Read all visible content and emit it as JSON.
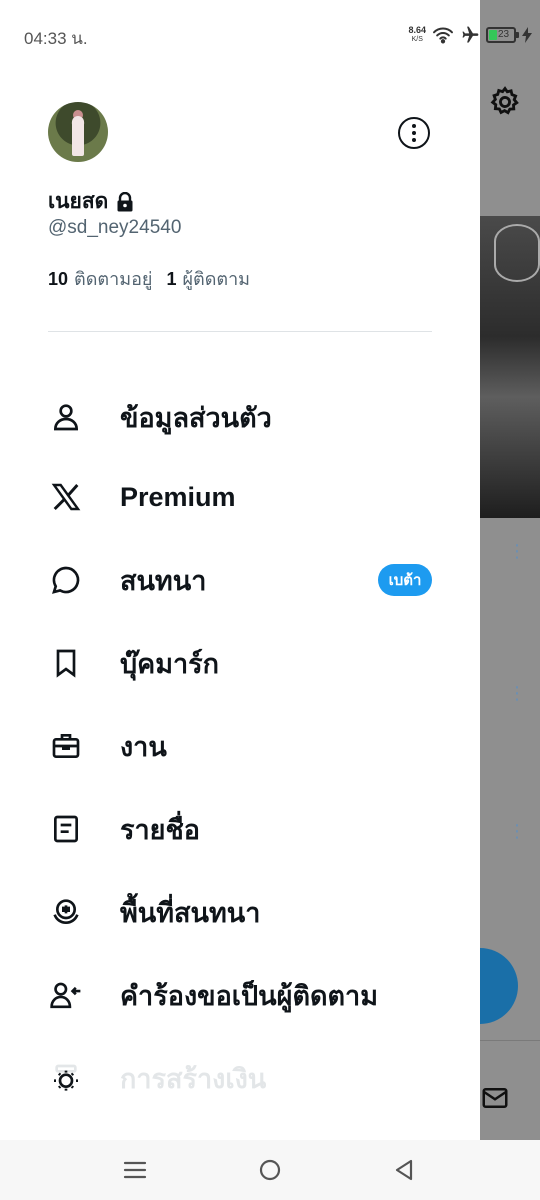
{
  "status_bar": {
    "time": "04:33 น.",
    "net_speed_value": "8.64",
    "net_speed_unit": "K/S",
    "battery_level": "23"
  },
  "profile": {
    "display_name": "เนยสด",
    "handle": "@sd_ney24540",
    "following_count": "10",
    "following_label": "ติดตามอยู่",
    "followers_count": "1",
    "followers_label": "ผู้ติดตาม"
  },
  "menu": {
    "items": [
      {
        "label": "ข้อมูลส่วนตัว",
        "icon": "person-icon"
      },
      {
        "label": "Premium",
        "icon": "x-logo-icon"
      },
      {
        "label": "สนทนา",
        "icon": "chat-bubble-icon",
        "badge": "เบต้า"
      },
      {
        "label": "บุ๊คมาร์ก",
        "icon": "bookmark-icon"
      },
      {
        "label": "งาน",
        "icon": "briefcase-icon"
      },
      {
        "label": "รายชื่อ",
        "icon": "list-icon"
      },
      {
        "label": "พื้นที่สนทนา",
        "icon": "spaces-icon"
      },
      {
        "label": "คำร้องขอเป็นผู้ติดตาม",
        "icon": "follow-request-icon"
      },
      {
        "label": "การสร้างเงิน",
        "icon": "monetization-icon"
      }
    ]
  },
  "colors": {
    "accent": "#1d9bf0",
    "text_primary": "#0f1419",
    "text_secondary": "#536471"
  }
}
